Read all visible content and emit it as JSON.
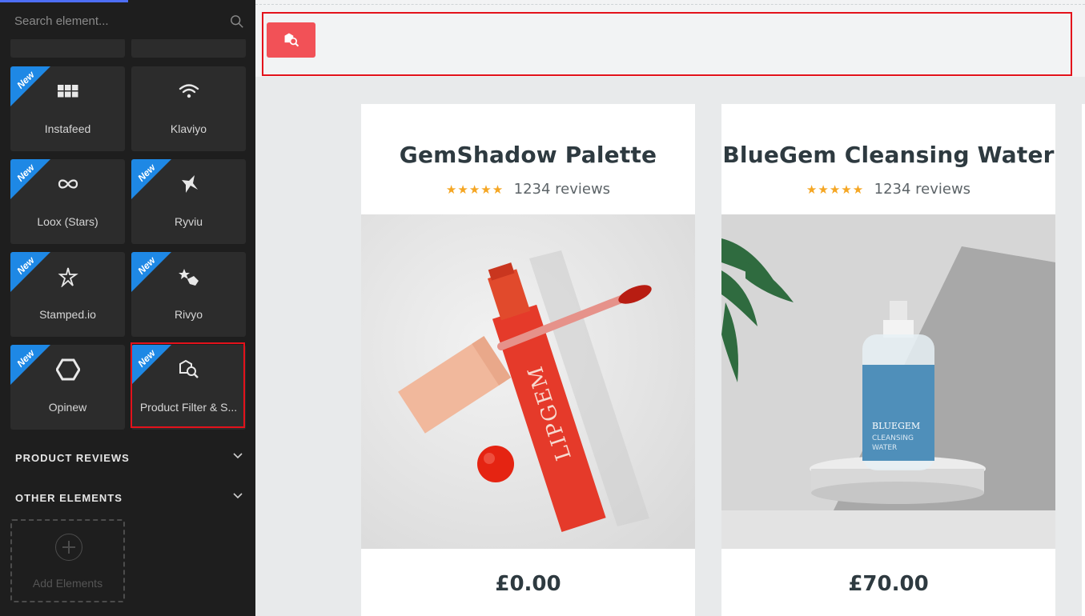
{
  "sidebar": {
    "search": {
      "placeholder": "Search element..."
    },
    "badge_text": "New",
    "tiles": [
      {
        "label": "Instafeed",
        "icon": "grid-icon"
      },
      {
        "label": "Klaviyo",
        "icon": "wifi-icon"
      },
      {
        "label": "Loox (Stars)",
        "icon": "infinity-icon"
      },
      {
        "label": "Ryviu",
        "icon": "star-icon"
      },
      {
        "label": "Stamped.io",
        "icon": "star-outline-icon"
      },
      {
        "label": "Rivyo",
        "icon": "star-hand-icon"
      },
      {
        "label": "Opinew",
        "icon": "hexagon-icon"
      },
      {
        "label": "Product Filter & S...",
        "icon": "product-search-icon"
      }
    ],
    "sections": [
      {
        "label": "PRODUCT REVIEWS"
      },
      {
        "label": "OTHER ELEMENTS"
      }
    ],
    "add_elements_label": "Add Elements"
  },
  "canvas": {
    "filter_button_icon": "product-search-icon",
    "accent_color": "#f25157",
    "products": [
      {
        "title": "GemShadow Palette",
        "stars": "★★★★★",
        "reviews": "1234 reviews",
        "price": "£0.00"
      },
      {
        "title": "BlueGem Cleansing Water",
        "stars": "★★★★★",
        "reviews": "1234 reviews",
        "price": "£70.00"
      }
    ]
  }
}
